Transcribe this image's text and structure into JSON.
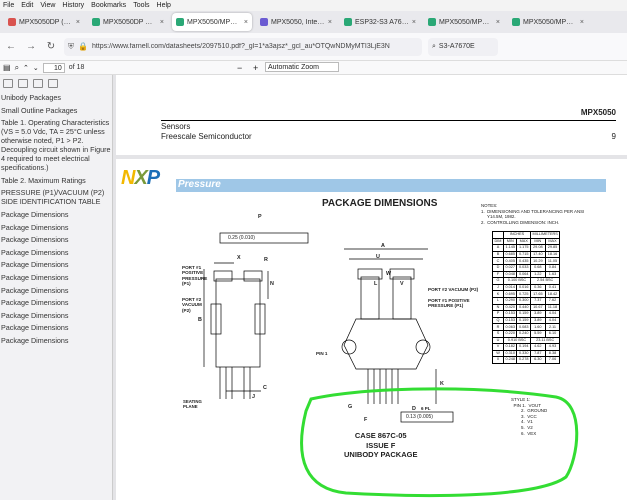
{
  "menu": [
    "File",
    "Edit",
    "View",
    "History",
    "Bookmarks",
    "Tools",
    "Help"
  ],
  "tabs": [
    {
      "label": "MPX5050DP (Blood",
      "color": "#d9534f",
      "active": false
    },
    {
      "label": "MPX5050DP NXP, P",
      "color": "#2aa876",
      "active": false
    },
    {
      "label": "MPX5050/MPXV505",
      "color": "#2aa876",
      "active": true
    },
    {
      "label": "MPX5050, Integrate",
      "color": "#6b5bd2",
      "active": false
    },
    {
      "label": "ESP32-S3 A7670E 4",
      "color": "#2aa876",
      "active": false
    },
    {
      "label": "MPX5050/MPXV5050G",
      "color": "#2aa876",
      "active": false
    },
    {
      "label": "MPX5050/MPXV5050G",
      "color": "#2aa876",
      "active": false
    }
  ],
  "url": "https://www.farnell.com/datasheets/2097510.pdf?_gl=1*a3ajsz*_gcl_au*OTQwNDMyMTI3LjE3N",
  "search_text": "S3-A7670E",
  "pdf": {
    "page": "10",
    "of": "of 18",
    "zoom": "Automatic Zoom"
  },
  "outline": [
    "Unibody Packages",
    "Small Outline Packages",
    "Table 1. Operating Characteristics (VS = 5.0 Vdc, TA = 25°C unless otherwise noted, P1 > P2. Decoupling circuit shown in Figure 4 required to meet electrical specifications.)",
    "Table 2. Maximum Ratings",
    "PRESSURE (P1)/VACUUM (P2) SIDE IDENTIFICATION TABLE",
    "Package Dimensions",
    "Package Dimensions",
    "Package Dimensions",
    "Package Dimensions",
    "Package Dimensions",
    "Package Dimensions",
    "Package Dimensions",
    "Package Dimensions",
    "Package Dimensions",
    "Package Dimensions",
    "Package Dimensions"
  ],
  "doc": {
    "part": "MPX5050",
    "sensors": "Sensors",
    "company": "Freescale Semiconductor",
    "page_no": "9",
    "logo": "NXP",
    "banner": "Pressure",
    "title": "PACKAGE DIMENSIONS",
    "notes": [
      "NOTES:",
      "1.  DIMENSIONING AND TOLERANCING PER ANSI",
      "     Y14.5M, 1982.",
      "2.  CONTROLLING DIMENSION: INCH."
    ],
    "table_groups": [
      "INCHES",
      "MILLIMETERS"
    ],
    "table_head": [
      "DIM",
      "MIN",
      "MAX",
      "MIN",
      "MAX"
    ],
    "table_rows": [
      [
        "A",
        "1.145",
        "1.175",
        "29.08",
        "29.85"
      ],
      [
        "B",
        "0.685",
        "0.715",
        "17.40",
        "18.16"
      ],
      [
        "C",
        "0.405",
        "0.435",
        "10.29",
        "11.05"
      ],
      [
        "D",
        "0.027",
        "0.033",
        "0.68",
        "0.84"
      ],
      [
        "F",
        "0.048",
        "0.064",
        "1.22",
        "1.63"
      ],
      [
        "G",
        "0.100 BSC",
        "",
        "2.54 BSC",
        ""
      ],
      [
        "J",
        "0.014",
        "0.016",
        "0.36",
        "0.41"
      ],
      [
        "K",
        "0.695",
        "0.725",
        "17.65",
        "18.42"
      ],
      [
        "L",
        "0.290",
        "0.300",
        "7.37",
        "7.62"
      ],
      [
        "N",
        "0.420",
        "0.440",
        "10.67",
        "11.18"
      ],
      [
        "P",
        "0.153",
        "0.159",
        "3.89",
        "4.04"
      ],
      [
        "Q",
        "0.153",
        "0.159",
        "3.89",
        "4.04"
      ],
      [
        "R",
        "0.063",
        "0.083",
        "1.60",
        "2.11"
      ],
      [
        "S",
        "0.220",
        "0.240",
        "5.59",
        "6.10"
      ],
      [
        "U",
        "0.910 BSC",
        "",
        "23.11 BSC",
        ""
      ],
      [
        "V",
        "0.182",
        "0.194",
        "4.62",
        "4.93"
      ],
      [
        "W",
        "0.310",
        "0.330",
        "7.87",
        "8.38"
      ],
      [
        "X",
        "0.248",
        "0.278",
        "6.30",
        "7.06"
      ]
    ],
    "style": [
      "STYLE 1:",
      "  PIN 1.  VOUT",
      "        2.  GROUND",
      "        3.  VCC",
      "        4.  V1",
      "        5.  V2",
      "        6.  VEX"
    ],
    "case": [
      "CASE 867C-05",
      "ISSUE F",
      "UNIBODY PACKAGE"
    ],
    "labels": {
      "p": "P",
      "x": "X",
      "r": "R",
      "n": "N",
      "b": "B",
      "c": "C",
      "j": "J",
      "a": "A",
      "u": "U",
      "l": "L",
      "v": "V",
      "w": "W",
      "k": "K",
      "g": "G",
      "f": "F",
      "d": "D",
      "six_pl": "6 PL",
      "q": "Q",
      "s": "S",
      "t": "T",
      "port1": "PORT #1\nPOSITIVE\nPRESSURE\n(P1)",
      "port2": "PORT #2\nVACUUM\n(P2)",
      "port2r": "PORT #2 VACUUM (P2)",
      "port1r": "PORT #1 POSITIVE\nPRESSURE (P1)",
      "pin1": "PIN 1",
      "seating": "SEATING\nPLANE",
      "tol1": "0.25 (0.010)",
      "tol2": "0.13 (0.005)"
    }
  },
  "colors": {
    "annotation": "#33dd33",
    "banner": "#9fc7e7"
  }
}
